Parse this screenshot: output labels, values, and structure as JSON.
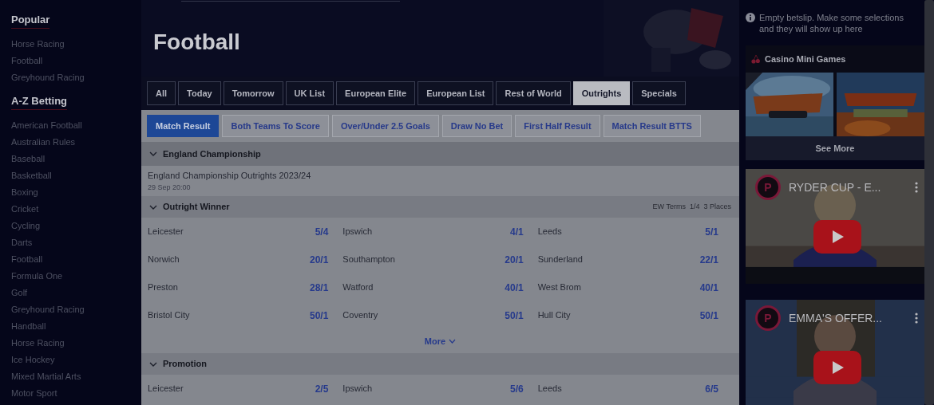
{
  "sidebar": {
    "sections": [
      {
        "title": "Popular",
        "items": [
          {
            "label": "Horse Racing"
          },
          {
            "label": "Football"
          },
          {
            "label": "Greyhound Racing"
          }
        ]
      },
      {
        "title": "A-Z Betting",
        "items": [
          {
            "label": "American Football"
          },
          {
            "label": "Australian Rules"
          },
          {
            "label": "Baseball"
          },
          {
            "label": "Basketball"
          },
          {
            "label": "Boxing"
          },
          {
            "label": "Cricket"
          },
          {
            "label": "Cycling"
          },
          {
            "label": "Darts"
          },
          {
            "label": "Football"
          },
          {
            "label": "Formula One"
          },
          {
            "label": "Golf"
          },
          {
            "label": "Greyhound Racing"
          },
          {
            "label": "Handball"
          },
          {
            "label": "Horse Racing"
          },
          {
            "label": "Ice Hockey"
          },
          {
            "label": "Mixed Martial Arts"
          },
          {
            "label": "Motor Sport"
          }
        ]
      }
    ]
  },
  "header": {
    "title": "Football"
  },
  "filter_tabs": [
    {
      "label": "All",
      "selected": false
    },
    {
      "label": "Today",
      "selected": false
    },
    {
      "label": "Tomorrow",
      "selected": false
    },
    {
      "label": "UK List",
      "selected": false
    },
    {
      "label": "European Elite",
      "selected": false
    },
    {
      "label": "European List",
      "selected": false
    },
    {
      "label": "Rest of World",
      "selected": false
    },
    {
      "label": "Outrights",
      "selected": true
    },
    {
      "label": "Specials",
      "selected": false
    }
  ],
  "market_tabs": [
    {
      "label": "Match Result",
      "selected": true
    },
    {
      "label": "Both Teams To Score",
      "selected": false
    },
    {
      "label": "Over/Under 2.5 Goals",
      "selected": false
    },
    {
      "label": "Draw No Bet",
      "selected": false
    },
    {
      "label": "First Half Result",
      "selected": false
    },
    {
      "label": "Match Result BTTS",
      "selected": false
    }
  ],
  "event_group": {
    "title": "England Championship",
    "expanded": true
  },
  "event": {
    "name": "England Championship Outrights 2023/24",
    "date": "29 Sep 20:00"
  },
  "markets": [
    {
      "title": "Outright Winner",
      "expanded": true,
      "terms": [
        "EW Terms",
        "1/4",
        "3 Places"
      ],
      "more": "More",
      "selections": [
        {
          "name": "Leicester",
          "odds": "5/4"
        },
        {
          "name": "Ipswich",
          "odds": "4/1"
        },
        {
          "name": "Leeds",
          "odds": "5/1"
        },
        {
          "name": "Norwich",
          "odds": "20/1"
        },
        {
          "name": "Southampton",
          "odds": "20/1"
        },
        {
          "name": "Sunderland",
          "odds": "22/1"
        },
        {
          "name": "Preston",
          "odds": "28/1"
        },
        {
          "name": "Watford",
          "odds": "40/1"
        },
        {
          "name": "West Brom",
          "odds": "40/1"
        },
        {
          "name": "Bristol City",
          "odds": "50/1"
        },
        {
          "name": "Coventry",
          "odds": "50/1"
        },
        {
          "name": "Hull City",
          "odds": "50/1"
        }
      ]
    },
    {
      "title": "Promotion",
      "expanded": true,
      "selections": [
        {
          "name": "Leicester",
          "odds": "2/5"
        },
        {
          "name": "Ipswich",
          "odds": "5/6"
        },
        {
          "name": "Leeds",
          "odds": "6/5"
        }
      ]
    }
  ],
  "betslip": {
    "message": "Empty betslip. Make some selections and they will show up here"
  },
  "casino": {
    "title": "Casino Mini Games",
    "see_more": "See More"
  },
  "videos": [
    {
      "channel": "P",
      "title": "RYDER CUP - E..."
    },
    {
      "channel": "P",
      "title": "EMMA'S OFFER..."
    }
  ]
}
